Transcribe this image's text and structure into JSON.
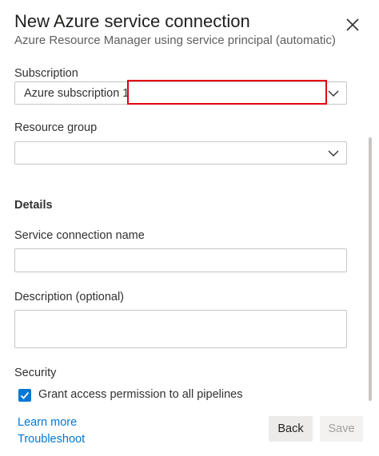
{
  "dialog": {
    "title": "New Azure service connection",
    "subtitle": "Azure Resource Manager using service principal (automatic)"
  },
  "subscription": {
    "label": "Subscription",
    "value": "Azure subscription 1"
  },
  "resource_group": {
    "label": "Resource group",
    "value": ""
  },
  "details": {
    "heading": "Details",
    "connection_name": {
      "label": "Service connection name",
      "value": ""
    },
    "description": {
      "label": "Description (optional)",
      "value": ""
    }
  },
  "security": {
    "label": "Security",
    "grant_access": {
      "label": "Grant access permission to all pipelines",
      "checked": true
    }
  },
  "links": {
    "learn_more": "Learn more",
    "troubleshoot": "Troubleshoot"
  },
  "buttons": {
    "back": "Back",
    "save": "Save"
  },
  "colors": {
    "accent": "#0078d4",
    "highlight": "#e3000f"
  }
}
